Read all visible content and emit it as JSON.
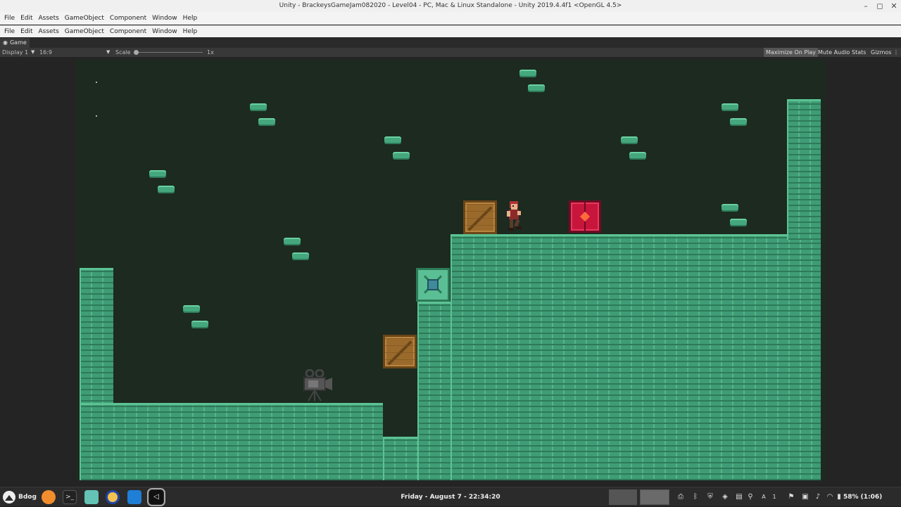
{
  "window": {
    "title": "Unity - BrackeysGameJam082020 - Level04 - PC, Mac & Linux Standalone - Unity 2019.4.4f1 <OpenGL 4.5>",
    "minimize": "–",
    "maximize": "◻"
  },
  "menu": [
    "File",
    "Edit",
    "Assets",
    "GameObject",
    "Component",
    "Window",
    "Help"
  ],
  "game_tab": {
    "icon": "gamepad-icon",
    "label": "Game"
  },
  "toolbar": {
    "display": "Display 1",
    "aspect": "16:9",
    "scale_label": "Scale",
    "scale_value": "1x",
    "maximize_on_play": "Maximize On Play",
    "mute_audio": "Mute Audio",
    "stats": "Stats",
    "gizmos": "Gizmos",
    "menu_icon": "⋮"
  },
  "taskbar": {
    "user": "Bdog",
    "clock": "Friday - August  7 - 22:34:20",
    "battery": "58% (1:06)",
    "apps": [
      "vlc-like-icon",
      "terminal-icon",
      "files-icon",
      "app-icon",
      "vscode-icon",
      "unity-icon"
    ],
    "tray": [
      "printer-icon",
      "bluetooth-icon",
      "shield-icon",
      "unity-tray-icon",
      "clipboard-icon",
      "location-icon",
      "keyboard-a-icon",
      "numlock-icon",
      "us-flag-icon",
      "device-icon",
      "volume-icon",
      "wifi-icon",
      "battery-icon"
    ]
  },
  "colors": {
    "game_background": "#1c2a20",
    "brick": "#3f9c76",
    "crate": "#9a6a2c",
    "door": "#c8153c"
  }
}
